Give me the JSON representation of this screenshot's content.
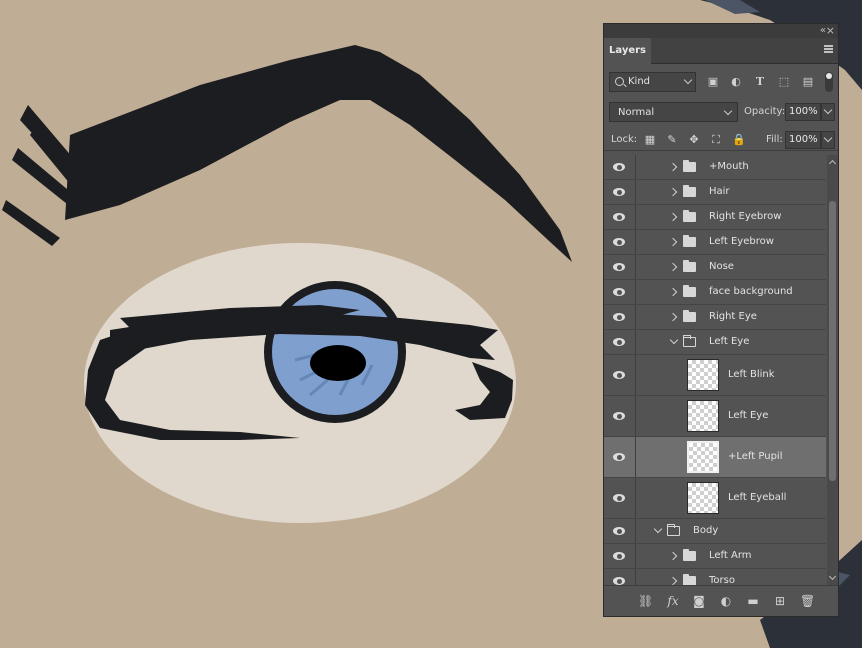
{
  "panel": {
    "collapse_glyph": "«",
    "close_glyph": "×",
    "tab_label": "Layers",
    "menu_icon": "panel-menu-icon"
  },
  "filter": {
    "kind_label": "Kind",
    "icons": [
      "image-filter-icon",
      "adjustment-filter-icon",
      "type-filter-icon",
      "shape-filter-icon",
      "smart-object-filter-icon"
    ]
  },
  "blend": {
    "mode": "Normal",
    "opacity_label": "Opacity:",
    "opacity_value": "100%"
  },
  "lock": {
    "label": "Lock:",
    "fill_label": "Fill:",
    "fill_value": "100%",
    "icons": [
      "lock-transparent-icon",
      "lock-paint-icon",
      "lock-position-icon",
      "lock-artboard-icon",
      "lock-all-icon"
    ]
  },
  "layers": [
    {
      "name": "+Mouth",
      "kind": "group",
      "expanded": false
    },
    {
      "name": "Hair",
      "kind": "group",
      "expanded": false
    },
    {
      "name": "Right Eyebrow",
      "kind": "group",
      "expanded": false
    },
    {
      "name": "Left Eyebrow",
      "kind": "group",
      "expanded": false
    },
    {
      "name": "Nose",
      "kind": "group",
      "expanded": false
    },
    {
      "name": "face background",
      "kind": "group",
      "expanded": false
    },
    {
      "name": "Right Eye",
      "kind": "group",
      "expanded": false
    },
    {
      "name": "Left Eye",
      "kind": "group",
      "expanded": true
    },
    {
      "name": "Left Blink",
      "kind": "layer"
    },
    {
      "name": "Left Eye",
      "kind": "layer"
    },
    {
      "name": "+Left Pupil",
      "kind": "layer",
      "selected": true
    },
    {
      "name": "Left Eyeball",
      "kind": "layer"
    },
    {
      "name": "Body",
      "kind": "group",
      "expanded": true
    },
    {
      "name": "Left Arm",
      "kind": "group",
      "expanded": false
    },
    {
      "name": "Torso",
      "kind": "group",
      "expanded": false
    }
  ],
  "bottom_icons": [
    "link-layers-icon",
    "fx-icon",
    "add-mask-icon",
    "adjustment-layer-icon",
    "new-group-icon",
    "new-layer-icon",
    "trash-icon"
  ],
  "colors": {
    "canvas_bg": "#c0ad95",
    "eye_white": "#e0d8cc",
    "ink": "#1c1d20",
    "iris": "#7fa0cf",
    "panel_bg": "#535353",
    "selected_row": "#6f6f6f"
  }
}
